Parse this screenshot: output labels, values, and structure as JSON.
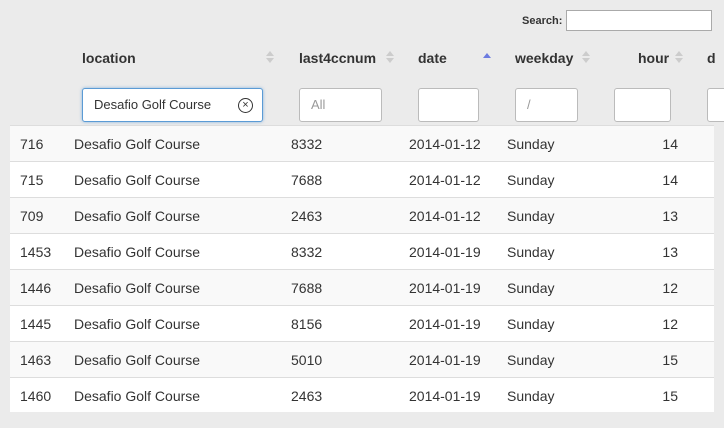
{
  "search": {
    "label": "Search:",
    "value": ""
  },
  "columns": [
    {
      "key": "location",
      "label": "location"
    },
    {
      "key": "last4ccnum",
      "label": "last4ccnum"
    },
    {
      "key": "date",
      "label": "date",
      "sort": "ascending"
    },
    {
      "key": "weekday",
      "label": "weekday"
    },
    {
      "key": "hour",
      "label": "hour"
    },
    {
      "key": "next",
      "label": "d"
    }
  ],
  "filters": {
    "location": {
      "value": "Desafio Golf Course",
      "clear_icon": "circle-x-icon"
    },
    "last4ccnum": {
      "placeholder": "All"
    },
    "date": {
      "value": ""
    },
    "weekday": {
      "value": "/"
    },
    "hour": {
      "value": ""
    }
  },
  "rows": [
    {
      "id": "716",
      "location": "Desafio Golf Course",
      "last4ccnum": "8332",
      "date": "2014-01-12",
      "weekday": "Sunday",
      "hour": "14"
    },
    {
      "id": "715",
      "location": "Desafio Golf Course",
      "last4ccnum": "7688",
      "date": "2014-01-12",
      "weekday": "Sunday",
      "hour": "14"
    },
    {
      "id": "709",
      "location": "Desafio Golf Course",
      "last4ccnum": "2463",
      "date": "2014-01-12",
      "weekday": "Sunday",
      "hour": "13"
    },
    {
      "id": "1453",
      "location": "Desafio Golf Course",
      "last4ccnum": "8332",
      "date": "2014-01-19",
      "weekday": "Sunday",
      "hour": "13"
    },
    {
      "id": "1446",
      "location": "Desafio Golf Course",
      "last4ccnum": "7688",
      "date": "2014-01-19",
      "weekday": "Sunday",
      "hour": "12"
    },
    {
      "id": "1445",
      "location": "Desafio Golf Course",
      "last4ccnum": "8156",
      "date": "2014-01-19",
      "weekday": "Sunday",
      "hour": "12"
    },
    {
      "id": "1463",
      "location": "Desafio Golf Course",
      "last4ccnum": "5010",
      "date": "2014-01-19",
      "weekday": "Sunday",
      "hour": "15"
    },
    {
      "id": "1460",
      "location": "Desafio Golf Course",
      "last4ccnum": "2463",
      "date": "2014-01-19",
      "weekday": "Sunday",
      "hour": "15"
    }
  ],
  "colors": {
    "sort_active": "#6c7be0",
    "focus_border": "#5b9bd5"
  }
}
